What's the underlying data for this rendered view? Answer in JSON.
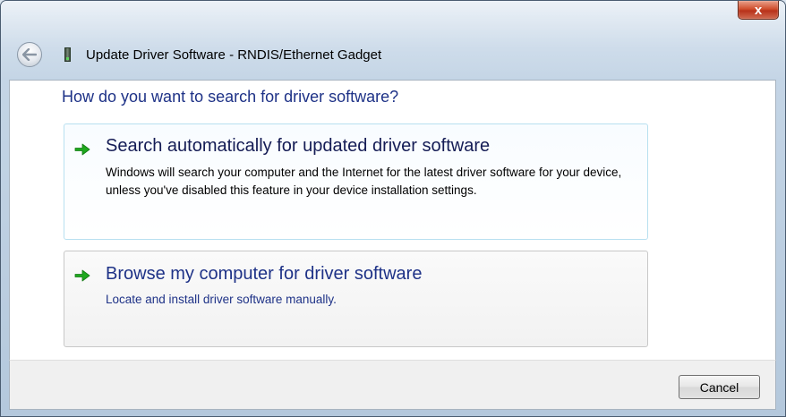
{
  "window": {
    "title": "Update Driver Software - RNDIS/Ethernet Gadget",
    "close_label": "x"
  },
  "icons": {
    "back": "back-arrow-icon",
    "device": "network-device-icon",
    "option_arrow": "green-arrow-icon"
  },
  "colors": {
    "heading": "#1e3287",
    "arrow_green": "#1ea81e",
    "close_red": "#c8452a"
  },
  "main": {
    "heading": "How do you want to search for driver software?",
    "options": [
      {
        "title": "Search automatically for updated driver software",
        "description": "Windows will search your computer and the Internet for the latest driver software for your device, unless you've disabled this feature in your device installation settings."
      },
      {
        "title": "Browse my computer for driver software",
        "description": "Locate and install driver software manually."
      }
    ]
  },
  "footer": {
    "cancel_label": "Cancel"
  }
}
